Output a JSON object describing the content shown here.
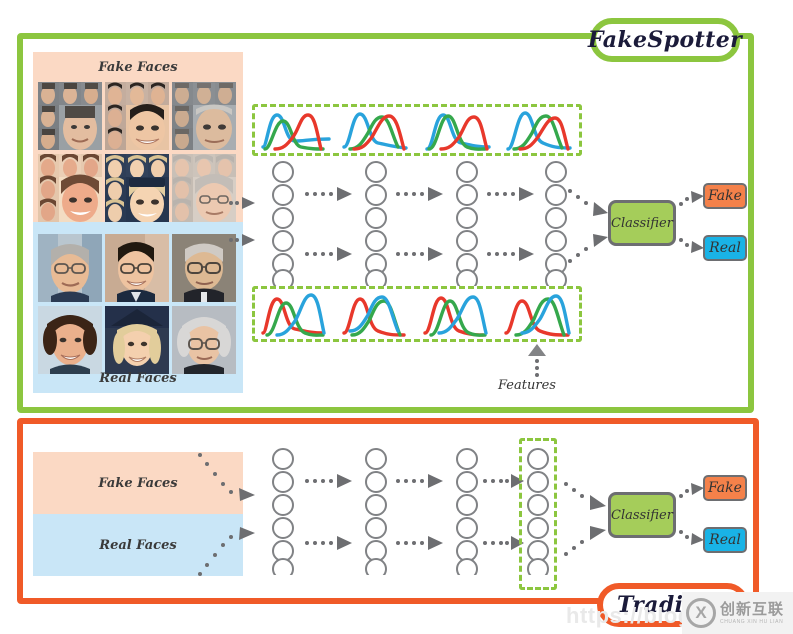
{
  "diagram": {
    "title_top": "FakeSpotter",
    "title_bottom": "Traditional",
    "features_label": "Features"
  },
  "fakespotter": {
    "fake_panel_label": "Fake Faces",
    "real_panel_label": "Real Faces",
    "classifier_label": "Classifier",
    "output_fake": "Fake",
    "output_real": "Real",
    "layer_count": 4,
    "nodes_per_layer": 6
  },
  "traditional": {
    "fake_panel_label": "Fake Faces",
    "real_panel_label": "Real Faces",
    "classifier_label": "Classifier",
    "output_fake": "Fake",
    "output_real": "Real",
    "layer_count": 4,
    "nodes_per_layer": 6
  },
  "colors": {
    "fakespotter_border": "#8cc63f",
    "traditional_border": "#f05a28",
    "fake_panel_bg": "#fbd9c4",
    "real_panel_bg": "#c9e6f7",
    "classifier_bg": "#a5cd5a",
    "fake_badge_bg": "#f4814a",
    "real_badge_bg": "#19b3e6",
    "curve_blue": "#29a3dc",
    "curve_green": "#35a84c",
    "curve_red": "#e8382b",
    "node_stroke": "#808285",
    "dashed_box": "#8cc63f"
  },
  "curves": {
    "top_row_order": [
      "blue",
      "green",
      "red"
    ],
    "bottom_row_order": [
      "red",
      "green",
      "blue"
    ],
    "groups_per_row": 4
  },
  "watermark": {
    "url": "https://blog.csdn",
    "logo_mark": "X",
    "logo_cn": "创新互联",
    "logo_pinyin": "CHUANG XIN HU LIAN"
  }
}
